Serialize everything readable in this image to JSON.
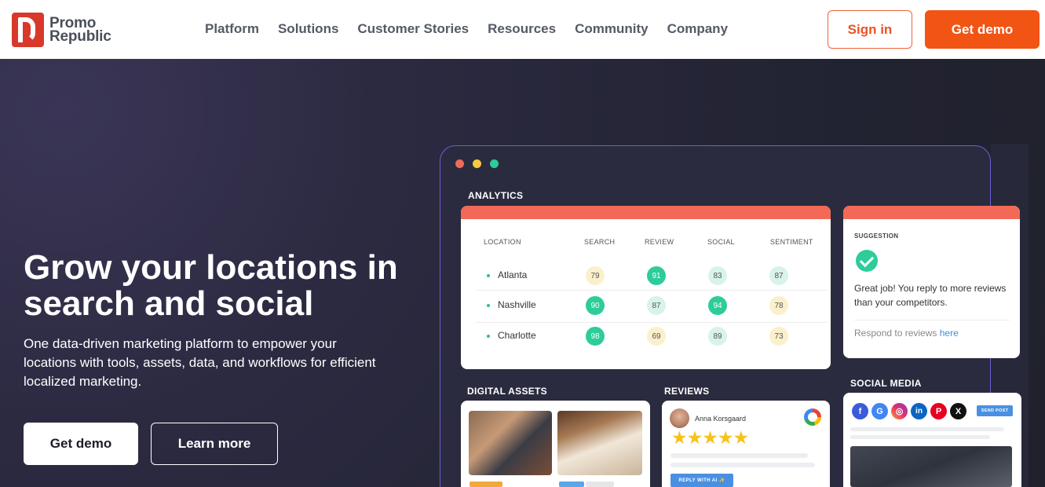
{
  "brand": {
    "line1": "Promo",
    "line2": "Republic",
    "color": "#d8392a"
  },
  "nav": {
    "items": [
      "Platform",
      "Solutions",
      "Customer Stories",
      "Resources",
      "Community",
      "Company"
    ],
    "sign_in": "Sign in",
    "get_demo": "Get demo",
    "accent": "#f25414"
  },
  "hero": {
    "title": "Grow your locations in search and social",
    "subtitle": "One data-driven marketing platform to empower your locations with tools, assets, data, and workflows for efficient localized marketing.",
    "primary_button": "Get demo",
    "secondary_button": "Learn more"
  },
  "dashboard": {
    "analytics_label": "ANALYTICS",
    "table": {
      "headers": [
        "LOCATION",
        "SEARCH",
        "REVIEW",
        "SOCIAL",
        "SENTIMENT"
      ],
      "rows": [
        {
          "location": "Atlanta",
          "search": "79",
          "review": "91",
          "social": "83",
          "sentiment": "87"
        },
        {
          "location": "Nashville",
          "search": "90",
          "review": "87",
          "social": "94",
          "sentiment": "78"
        },
        {
          "location": "Charlotte",
          "search": "98",
          "review": "69",
          "social": "89",
          "sentiment": "73"
        }
      ]
    },
    "suggestion": {
      "title": "SUGGESTION",
      "text": "Great job! You reply to more reviews than your competitors.",
      "link_prefix": "Respond to reviews",
      "link": "here"
    },
    "digital_assets_label": "DIGITAL ASSETS",
    "reviews_label": "REVIEWS",
    "social_media_label": "SOCIAL MEDIA",
    "review": {
      "name": "Anna Korsgaard",
      "stars": "★★★★★",
      "reply_button": "REPLY WITH AI ✨"
    },
    "social": {
      "send_post": "SEND POST",
      "icons": [
        "facebook-icon",
        "google-icon",
        "instagram-icon",
        "linkedin-icon",
        "pinterest-icon",
        "x-icon"
      ]
    }
  }
}
